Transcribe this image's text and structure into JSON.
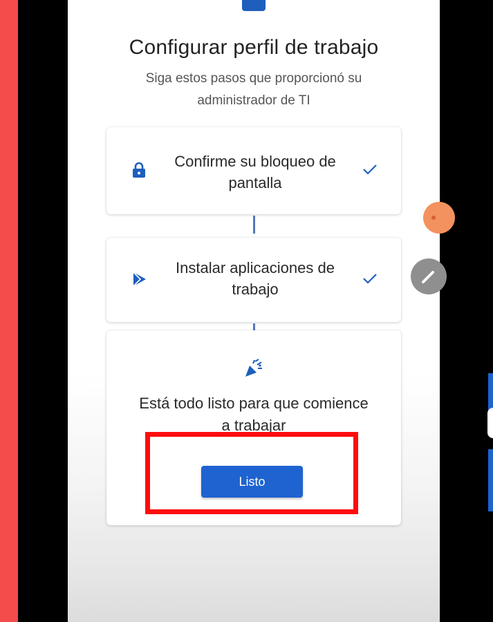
{
  "header": {
    "title": "Configurar perfil de trabajo",
    "subtitle": "Siga estos pasos que proporcionó su administrador de TI"
  },
  "steps": [
    {
      "label": "Confirme su bloqueo de pantalla",
      "icon": "lock-icon",
      "status": "completed"
    },
    {
      "label": "Instalar aplicaciones de trabajo",
      "icon": "play-store-icon",
      "status": "completed"
    }
  ],
  "done": {
    "icon": "party-popper-icon",
    "text": "Está todo listo para que comience a trabajar",
    "button_label": "Listo"
  },
  "colors": {
    "accent": "#1e63d0",
    "highlight": "#ff0d0d",
    "outer_background": "#f44b4b"
  }
}
